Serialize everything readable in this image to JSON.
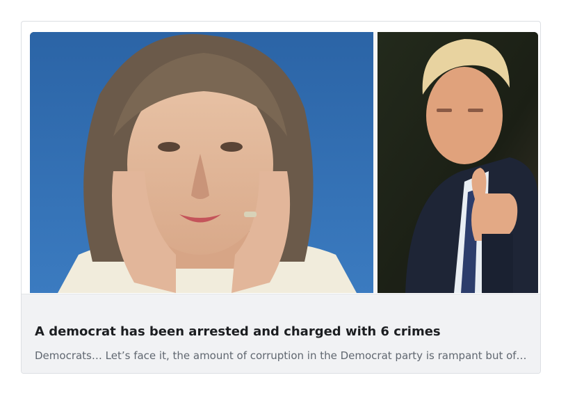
{
  "link_preview": {
    "title": "A democrat has been arrested and charged with 6 crimes",
    "description": "Democrats… Let’s face it, the amount of corruption in the Democrat party is rampant but of…",
    "image_left_bg": "#2f6aa8",
    "image_right_bg": "#1d2016"
  }
}
